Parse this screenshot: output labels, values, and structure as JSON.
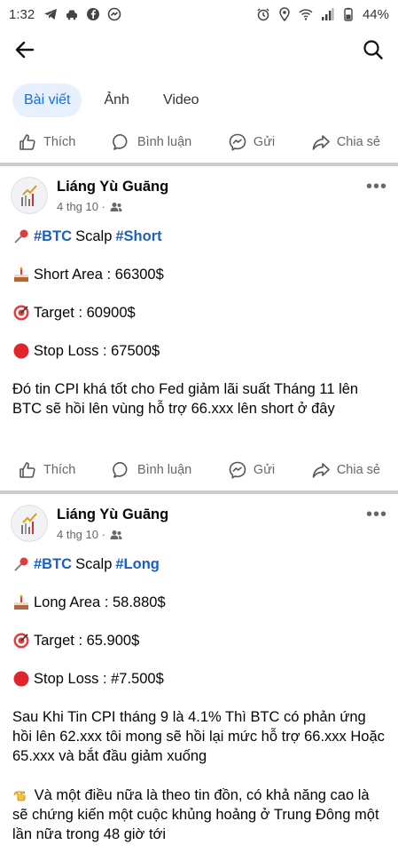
{
  "status": {
    "time": "1:32",
    "battery": "44%"
  },
  "tabs": [
    {
      "label": "Bài viết"
    },
    {
      "label": "Ảnh"
    },
    {
      "label": "Video"
    }
  ],
  "actions": {
    "like": "Thích",
    "comment": "Bình luận",
    "send": "Gửi",
    "share": "Chia sẻ"
  },
  "posts": [
    {
      "author": "Liáng Yù Guāng",
      "date": "4 thg 10 ·",
      "tags": {
        "btc": "#BTC",
        "scalp": "Scalp",
        "dir": "#Short"
      },
      "area": "Short Area : 66300$",
      "target": "Target : 60900$",
      "stop": "Stop Loss : 67500$",
      "text1": "Đó tin CPI khá tốt cho Fed giảm lãi suất Tháng 11 lên BTC sẽ hồi lên vùng hỗ trợ 66.xxx lên short ở đây"
    },
    {
      "author": "Liáng Yù Guāng",
      "date": "4 thg 10 ·",
      "tags": {
        "btc": "#BTC",
        "scalp": "Scalp",
        "dir": "#Long"
      },
      "area": "Long Area : 58.880$",
      "target": "Target : 65.900$",
      "stop": "Stop Loss : #7.500$",
      "text1": "Sau Khi Tin CPI tháng 9 là 4.1% Thì BTC có phản ứng hồi lên 62.xxx tôi mong sẽ hồi lại mức hỗ trợ 66.xxx Hoặc 65.xxx và bắt đầu giảm xuống",
      "text2": "Và một điều nữa là theo tin đồn, có khả năng cao là sẽ chứng kiến một cuộc khủng hoảng ở Trung Đông một lần nữa trong 48 giờ tới"
    }
  ]
}
